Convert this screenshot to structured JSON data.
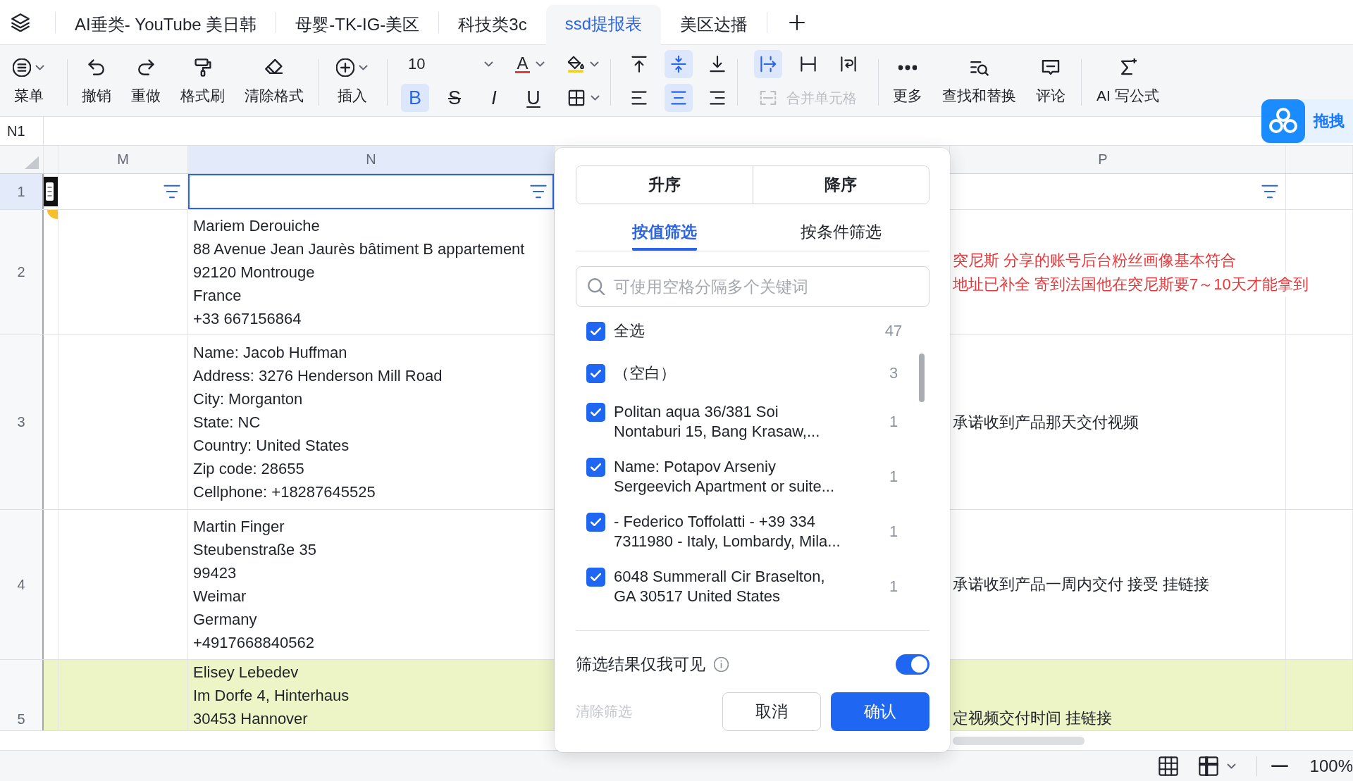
{
  "tabs": [
    {
      "label": "AI垂类- YouTube 美日韩",
      "selected": false
    },
    {
      "label": "母婴-TK-IG-美区",
      "selected": false
    },
    {
      "label": "科技类3c",
      "selected": false
    },
    {
      "label": "ssd提报表",
      "selected": true
    },
    {
      "label": "美区达播",
      "selected": false
    }
  ],
  "toolbar": {
    "left_groups": [
      [
        {
          "kind": "menu",
          "label": "菜单"
        }
      ],
      [
        {
          "kind": "undo",
          "label": "撤销"
        },
        {
          "kind": "redo",
          "label": "重做"
        },
        {
          "kind": "painter",
          "label": "格式刷"
        },
        {
          "kind": "eraser",
          "label": "清除格式"
        }
      ],
      [
        {
          "kind": "insert",
          "label": "插入"
        }
      ]
    ],
    "font_size": "10",
    "font_color": {
      "label": "A"
    },
    "text_styles": [
      {
        "kind": "bold",
        "label": "B",
        "selected": true
      },
      {
        "kind": "strike",
        "label": "S",
        "selected": false
      },
      {
        "kind": "italic",
        "label": "I",
        "selected": false
      },
      {
        "kind": "underline",
        "label": "U",
        "selected": false
      }
    ],
    "vertical_align": [
      {
        "kind": "top",
        "selected": false
      },
      {
        "kind": "middle",
        "selected": true
      },
      {
        "kind": "bottom",
        "selected": false
      }
    ],
    "horizontal_align": [
      {
        "kind": "left",
        "selected": false
      },
      {
        "kind": "center",
        "selected": true
      },
      {
        "kind": "right",
        "selected": false
      }
    ],
    "text_wrap": [
      {
        "kind": "overflow",
        "selected": true
      },
      {
        "kind": "clip",
        "selected": false
      },
      {
        "kind": "wrap",
        "selected": false
      }
    ],
    "merge_cells": {
      "label": "合并单元格",
      "disabled": true
    },
    "right_groups": [
      [
        {
          "kind": "more",
          "label": "更多"
        },
        {
          "kind": "find",
          "label": "查找和替换"
        },
        {
          "kind": "comment",
          "label": "评论"
        }
      ],
      [
        {
          "kind": "formula",
          "label": "AI 写公式"
        }
      ]
    ]
  },
  "formula_bar": {
    "cell": "N1"
  },
  "drag_button": {
    "label": "拖拽"
  },
  "sheet": {
    "columns": [
      {
        "label": "M",
        "selected": false
      },
      {
        "label": "N",
        "selected": true
      },
      {
        "label": "P",
        "selected": false
      }
    ],
    "rows": [
      {
        "kind": "filters",
        "number": "1",
        "selected": true,
        "highlighted": false
      },
      {
        "kind": "record",
        "number": "2",
        "selected": false,
        "highlighted": false,
        "address": "Mariem Derouiche\n88 Avenue Jean Jaurès bâtiment B appartement\n92120 Montrouge\nFrance\n+33 667156864",
        "note": {
          "lines": [
            "突尼斯 分享的账号后台粉丝画像基本符合",
            "地址已补全 寄到法国他在突尼斯要7～10天才能拿到"
          ],
          "color": "#e5383b"
        }
      },
      {
        "kind": "record",
        "number": "3",
        "selected": false,
        "highlighted": false,
        "address": "Name: Jacob Huffman\nAddress: 3276 Henderson Mill Road\nCity: Morganton\nState: NC\nCountry: United States\nZip code: 28655\nCellphone: +18287645525",
        "note": {
          "lines": [
            "承诺收到产品那天交付视频"
          ],
          "color": "#1f2329"
        }
      },
      {
        "kind": "record",
        "number": "4",
        "selected": false,
        "highlighted": false,
        "address": "Martin Finger\nSteubenstraße 35\n99423\nWeimar\nGermany\n+4917668840562",
        "note": {
          "lines": [
            "承诺收到产品一周内交付 接受 挂链接"
          ],
          "color": "#1f2329"
        }
      },
      {
        "kind": "record",
        "number": "5",
        "selected": false,
        "highlighted": true,
        "address": "Elisey Lebedev\nIm Dorfe 4, Hinterhaus\n30453 Hannover",
        "note": {
          "lines": [
            "定视频交付时间 挂链接"
          ],
          "color": "#1f2329"
        }
      }
    ]
  },
  "filter_popup": {
    "sort_buttons": [
      "升序",
      "降序"
    ],
    "tabs": [
      {
        "label": "按值筛选",
        "selected": true
      },
      {
        "label": "按条件筛选",
        "selected": false
      }
    ],
    "search": {
      "placeholder": "可使用空格分隔多个关键词"
    },
    "values": [
      {
        "label": "全选",
        "count": "47",
        "checked": true
      },
      {
        "label": "（空白）",
        "count": "3",
        "checked": true
      },
      {
        "label": "Politan aqua 36/381 Soi\nNontaburi 15, Bang Krasaw,...",
        "count": "1",
        "checked": true
      },
      {
        "label": "Name: Potapov Arseniy\nSergeevich Apartment or suite...",
        "count": "1",
        "checked": true
      },
      {
        "label": "- Federico Toffolatti - +39 334\n7311980 - Italy, Lombardy, Mila...",
        "count": "1",
        "checked": true
      },
      {
        "label": "6048 Summerall Cir Braselton,\nGA 30517 United States",
        "count": "1",
        "checked": true
      }
    ],
    "visibility": {
      "label": "筛选结果仅我可见",
      "on": true
    },
    "clear": {
      "label": "清除筛选",
      "disabled": true
    },
    "buttons": [
      {
        "kind": "secondary",
        "label": "取消"
      },
      {
        "kind": "primary",
        "label": "确认"
      }
    ]
  },
  "status_bar": {
    "zoom": "100%"
  }
}
